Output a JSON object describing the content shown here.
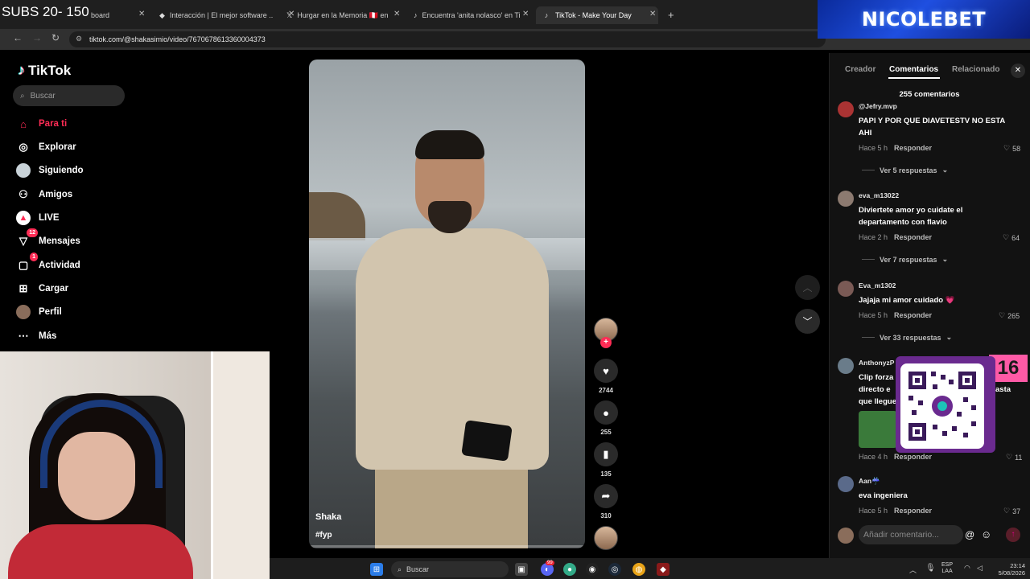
{
  "overlay": {
    "subs_text": "SUBS 20- 150",
    "sponsor": "NICOLEBET",
    "pink_number": "16"
  },
  "browser": {
    "tabs": [
      {
        "label": "hboard",
        "icon": "dashboard-icon"
      },
      {
        "label": "Interacción | El mejor software ...",
        "icon": "generic-site-icon"
      },
      {
        "label": "Hurgar en la Memoria 🇵🇪 en X",
        "icon": "x-icon"
      },
      {
        "label": "Encuentra 'anita nolasco' en TikTok",
        "icon": "tiktok-icon"
      },
      {
        "label": "TikTok - Make Your Day",
        "icon": "tiktok-icon"
      }
    ],
    "url": "tiktok.com/@shakasimio/video/7670678613360004373"
  },
  "tiktok": {
    "logo": "TikTok",
    "search_placeholder": "Buscar",
    "nav": [
      {
        "label": "Para ti",
        "icon": "home-icon"
      },
      {
        "label": "Explorar",
        "icon": "compass-icon"
      },
      {
        "label": "Siguiendo",
        "icon": "following-icon"
      },
      {
        "label": "Amigos",
        "icon": "friends-icon"
      },
      {
        "label": "LIVE",
        "icon": "live-icon"
      },
      {
        "label": "Mensajes",
        "icon": "messages-icon",
        "badge": "12"
      },
      {
        "label": "Actividad",
        "icon": "activity-icon",
        "badge": "1"
      },
      {
        "label": "Cargar",
        "icon": "upload-icon"
      },
      {
        "label": "Perfil",
        "icon": "profile-icon"
      },
      {
        "label": "Más",
        "icon": "more-icon"
      }
    ],
    "video": {
      "author": "Shaka",
      "caption": "#fyp"
    },
    "actions": {
      "likes": "2744",
      "comments": "255",
      "saves": "135",
      "shares": "310"
    },
    "panel": {
      "tabs": [
        "Creador",
        "Comentarios",
        "Relacionado"
      ],
      "comment_count": "255 comentarios",
      "comments": [
        {
          "user": "@Jefry.mvp",
          "text": "PAPI Y POR QUE DIAVETESTV NO ESTA AHI",
          "time": "Hace 5 h",
          "reply": "Responder",
          "likes": "58",
          "replies": "Ver 5 respuestas"
        },
        {
          "user": "eva_m13022",
          "text": "Diviertete amor yo cuidate el departamento con flavio",
          "time": "Hace 2 h",
          "reply": "Responder",
          "likes": "64",
          "replies": "Ver 7 respuestas"
        },
        {
          "user": "Eva_m1302",
          "text": "Jajaja mi amor cuidado 💗",
          "time": "Hace 5 h",
          "reply": "Responder",
          "likes": "265",
          "replies": "Ver 33 respuestas"
        },
        {
          "user": "AnthonyzP",
          "text": "Clip forza directo e que llegue",
          "text_tail": "asta",
          "time": "Hace 4 h",
          "reply": "Responder",
          "likes": "11"
        },
        {
          "user": "Aan☔",
          "text": "eva ingeniera",
          "time": "Hace 5 h",
          "reply": "Responder",
          "likes": "37"
        }
      ],
      "add_comment_placeholder": "Añadir comentario..."
    }
  },
  "taskbar": {
    "search": "Buscar",
    "lang_1": "ESP",
    "lang_2": "LAA",
    "time": "23:14",
    "date": "5/08/2026",
    "discord_badge": "99"
  }
}
